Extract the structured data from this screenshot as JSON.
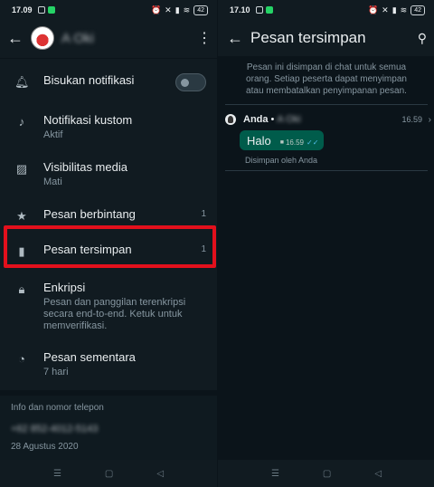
{
  "left": {
    "status": {
      "time": "17.09",
      "battery": "42"
    },
    "header": {
      "contact_name": "A Oki"
    },
    "settings": [
      {
        "title": "Bisukan notifikasi",
        "toggle": false
      },
      {
        "title": "Notifikasi kustom",
        "sub": "Aktif"
      },
      {
        "title": "Visibilitas media",
        "sub": "Mati"
      },
      {
        "title": "Pesan berbintang",
        "count": "1"
      },
      {
        "title": "Pesan tersimpan",
        "count": "1",
        "highlighted": true
      },
      {
        "title": "Enkripsi",
        "sub": "Pesan dan panggilan terenkripsi secara end-to-end. Ketuk untuk memverifikasi."
      },
      {
        "title": "Pesan sementara",
        "sub": "7 hari"
      }
    ],
    "info": {
      "header": "Info dan nomor telepon",
      "phone": "+62 852-4012-5143",
      "date": "28 Agustus 2020"
    }
  },
  "right": {
    "status": {
      "time": "17.10",
      "battery": "42"
    },
    "header": {
      "title": "Pesan tersimpan"
    },
    "notice": "Pesan ini disimpan di chat untuk semua orang. Setiap peserta dapat menyimpan atau membatalkan penyimpanan pesan.",
    "message": {
      "sender": "Anda",
      "separator": "•",
      "receiver": "A Oki",
      "time": "16.59",
      "text": "Halo",
      "bubble_time": "16.59",
      "saved_by": "Disimpan oleh Anda"
    }
  },
  "icons": {
    "back": "arrow-left",
    "menu": "more-vertical",
    "search": "search",
    "bell": "bell",
    "music": "music-note",
    "image": "image",
    "star": "star",
    "bookmark": "bookmark",
    "lock": "lock",
    "timer": "timer"
  },
  "colors": {
    "background": "#111b21",
    "bubble": "#005c4b",
    "highlight": "#e3101c",
    "ticks": "#53bdeb"
  }
}
